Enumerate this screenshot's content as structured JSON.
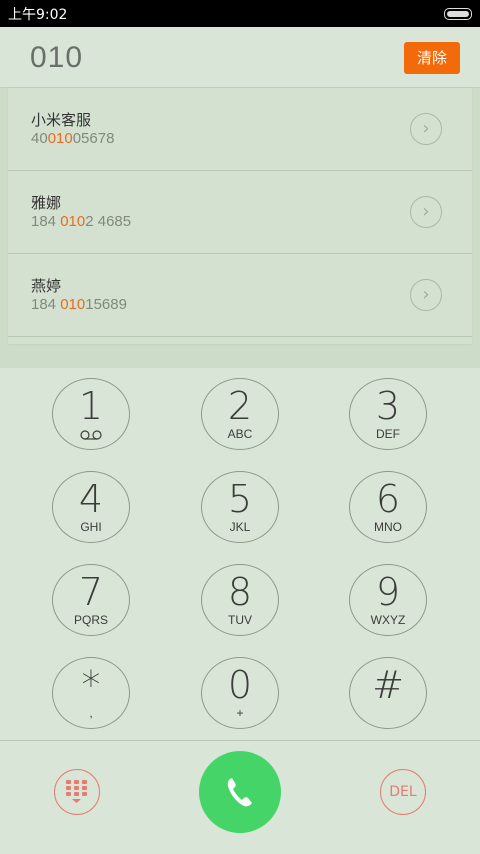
{
  "status_bar": {
    "time": "上午9:02"
  },
  "dialer": {
    "number": "010",
    "clear_label": "清除"
  },
  "results": [
    {
      "name": "小米客服",
      "number_pre": "40",
      "number_match": "010",
      "number_post": "05678"
    },
    {
      "name": "雅娜",
      "number_pre": "184 ",
      "number_match": "010",
      "number_post": "2 4685"
    },
    {
      "name": "燕婷",
      "number_pre": "184 ",
      "number_match": "010",
      "number_post": "15689"
    }
  ],
  "keys": [
    {
      "digit": "1",
      "letters": ""
    },
    {
      "digit": "2",
      "letters": "ABC"
    },
    {
      "digit": "3",
      "letters": "DEF"
    },
    {
      "digit": "4",
      "letters": "GHI"
    },
    {
      "digit": "5",
      "letters": "JKL"
    },
    {
      "digit": "6",
      "letters": "MNO"
    },
    {
      "digit": "7",
      "letters": "PQRS"
    },
    {
      "digit": "8",
      "letters": "TUV"
    },
    {
      "digit": "9",
      "letters": "WXYZ"
    },
    {
      "digit": "*",
      "letters": ","
    },
    {
      "digit": "0",
      "letters": "+"
    },
    {
      "digit": "#",
      "letters": ""
    }
  ],
  "bottom_bar": {
    "del_label": "DEL"
  },
  "colors": {
    "accent": "#f26a09",
    "match": "#e96c1e",
    "call": "#45d467",
    "icon_red": "#e57b73"
  }
}
